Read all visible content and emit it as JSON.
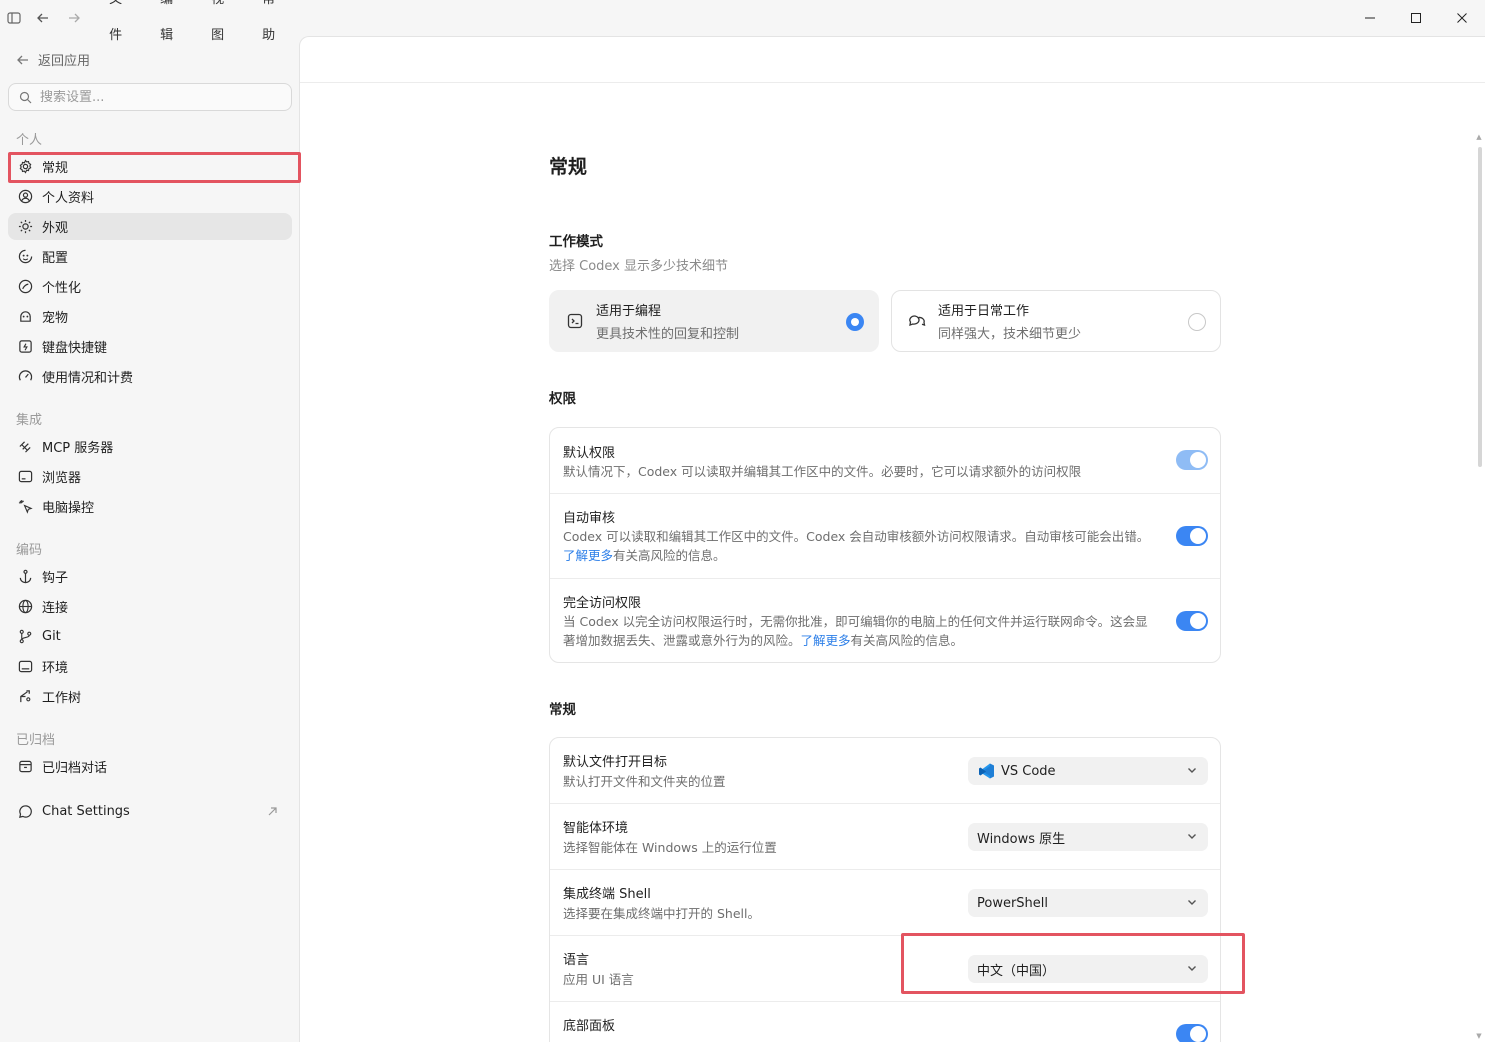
{
  "menu": [
    "文件",
    "编辑",
    "视图",
    "帮助"
  ],
  "sidebar": {
    "back_label": "返回应用",
    "search_placeholder": "搜索设置...",
    "sections": {
      "personal": "个人",
      "integration": "集成",
      "coding": "编码",
      "archived": "已归档"
    },
    "items": [
      {
        "label": "常规",
        "icon": "gear-icon"
      },
      {
        "label": "个人资料",
        "icon": "profile-icon"
      },
      {
        "label": "外观",
        "icon": "sun-icon"
      },
      {
        "label": "配置",
        "icon": "config-icon"
      },
      {
        "label": "个性化",
        "icon": "personalize-icon"
      },
      {
        "label": "宠物",
        "icon": "pet-icon"
      },
      {
        "label": "键盘快捷键",
        "icon": "keyboard-icon"
      },
      {
        "label": "使用情况和计费",
        "icon": "gauge-icon"
      },
      {
        "label": "MCP 服务器",
        "icon": "mcp-icon"
      },
      {
        "label": "浏览器",
        "icon": "browser-icon"
      },
      {
        "label": "电脑操控",
        "icon": "cursor-icon"
      },
      {
        "label": "钩子",
        "icon": "anchor-icon"
      },
      {
        "label": "连接",
        "icon": "globe-icon"
      },
      {
        "label": "Git",
        "icon": "git-icon"
      },
      {
        "label": "环境",
        "icon": "terminal-icon"
      },
      {
        "label": "工作树",
        "icon": "worktree-icon"
      },
      {
        "label": "已归档对话",
        "icon": "archive-icon"
      },
      {
        "label": "Chat Settings",
        "icon": "chat-icon"
      }
    ]
  },
  "main": {
    "title": "常规",
    "work_mode": {
      "heading": "工作模式",
      "desc": "选择 Codex 显示多少技术细节",
      "options": [
        {
          "title": "适用于编程",
          "desc": "更具技术性的回复和控制",
          "selected": true
        },
        {
          "title": "适用于日常工作",
          "desc": "同样强大，技术细节更少",
          "selected": false
        }
      ]
    },
    "permissions": {
      "heading": "权限",
      "rows": [
        {
          "title": "默认权限",
          "desc": "默认情况下，Codex 可以读取并编辑其工作区中的文件。必要时，它可以请求额外的访问权限",
          "enabled": true
        },
        {
          "title": "自动审核",
          "desc": "Codex 可以读取和编辑其工作区中的文件。Codex 会自动审核额外访问权限请求。自动审核可能会出错。",
          "link": "了解更多",
          "desc_after": "有关高风险的信息。",
          "enabled": true
        },
        {
          "title": "完全访问权限",
          "desc": "当 Codex 以完全访问权限运行时，无需你批准，即可编辑你的电脑上的任何文件并运行联网命令。这会显著增加数据丢失、泄露或意外行为的风险。",
          "link": "了解更多",
          "desc_after": "有关高风险的信息。",
          "enabled": true
        }
      ]
    },
    "general": {
      "heading": "常规",
      "rows": [
        {
          "title": "默认文件打开目标",
          "desc": "默认打开文件和文件夹的位置",
          "value": "VS Code"
        },
        {
          "title": "智能体环境",
          "desc": "选择智能体在 Windows 上的运行位置",
          "value": "Windows 原生"
        },
        {
          "title": "集成终端 Shell",
          "desc": "选择要在集成终端中打开的 Shell。",
          "value": "PowerShell"
        },
        {
          "title": "语言",
          "desc": "应用 UI 语言",
          "value": "中文（中国）"
        },
        {
          "title": "底部面板",
          "enabled": true
        }
      ]
    }
  },
  "colors": {
    "accent": "#3b86f3",
    "highlight": "#e35460",
    "link": "#2d7fe8"
  }
}
